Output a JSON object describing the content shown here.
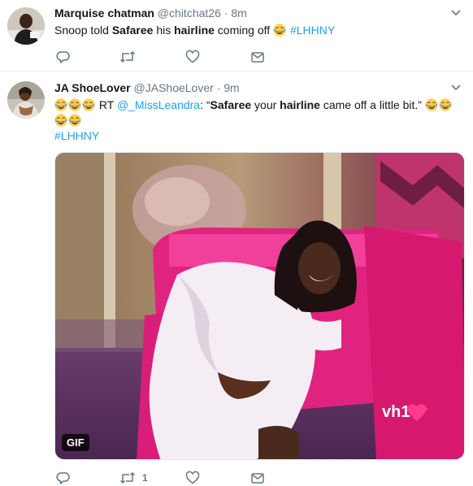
{
  "tweets": [
    {
      "fullname": "Marquise chatman",
      "handle": "@chitchat26",
      "dot": "·",
      "time": "8m",
      "text": {
        "t1": "Snoop told ",
        "b1": "Safaree",
        "t2": " his ",
        "b2": "hairline",
        "t3": " coming off ",
        "hashtag": "#LHHNY"
      },
      "actions": {
        "reply_count": "",
        "retweet_count": "",
        "like_count": ""
      }
    },
    {
      "fullname": "JA ShoeLover",
      "handle": "@JAShoeLover",
      "dot": "·",
      "time": "9m",
      "text": {
        "t1": " RT ",
        "mention": "@_MissLeandra",
        "t2": ": “",
        "b1": "Safaree",
        "t3": " your ",
        "b2": "hairline",
        "t4": " came off a little bit.” ",
        "hashtag": "#LHHNY"
      },
      "media": {
        "badge": "GIF",
        "watermark": "vh1"
      },
      "actions": {
        "reply_count": "",
        "retweet_count": "1",
        "like_count": ""
      }
    }
  ],
  "icons": [
    "reply-icon",
    "retweet-icon",
    "like-icon",
    "direct-message-icon",
    "chevron-down-icon",
    "laughing-emoji"
  ],
  "colors": {
    "link": "#1da1f2",
    "muted": "#657786",
    "text": "#14171a",
    "divider": "#e6ecf0"
  }
}
